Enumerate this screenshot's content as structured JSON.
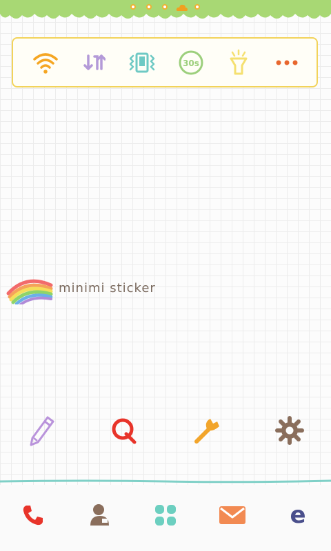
{
  "status_bar": {
    "page_indicator": {
      "count": 5,
      "active_index": 3
    }
  },
  "quick_settings": {
    "items": [
      {
        "name": "wifi-icon",
        "color": "#f5a623"
      },
      {
        "name": "data-sync-icon",
        "color": "#b49ad8"
      },
      {
        "name": "vibrate-icon",
        "color": "#6ec9c4"
      },
      {
        "name": "screen-timeout-icon",
        "color": "#9ccf7c",
        "label": "30s"
      },
      {
        "name": "flashlight-icon",
        "color": "#f5e070"
      },
      {
        "name": "more-icon",
        "color": "#e8672e"
      }
    ],
    "border_color": "#f2d35a"
  },
  "widget": {
    "brand_text": "minimi sticker"
  },
  "tools": [
    {
      "name": "pencil-icon",
      "color": "#b993db"
    },
    {
      "name": "search-q-icon",
      "color": "#e8342a"
    },
    {
      "name": "wrench-icon",
      "color": "#f2a52b"
    },
    {
      "name": "gear-icon",
      "color": "#8a6e5c"
    }
  ],
  "dock": [
    {
      "name": "phone-icon",
      "color": "#e8342a"
    },
    {
      "name": "contacts-icon",
      "color": "#8a6e5c"
    },
    {
      "name": "apps-icon",
      "color": "#6ccfc0"
    },
    {
      "name": "mail-icon",
      "color": "#f28a52"
    },
    {
      "name": "browser-icon",
      "color": "#4a4f8c",
      "label": "e"
    }
  ],
  "theme": {
    "grass_color": "#a8d874",
    "dock_line_color": "#7fd0c7"
  }
}
